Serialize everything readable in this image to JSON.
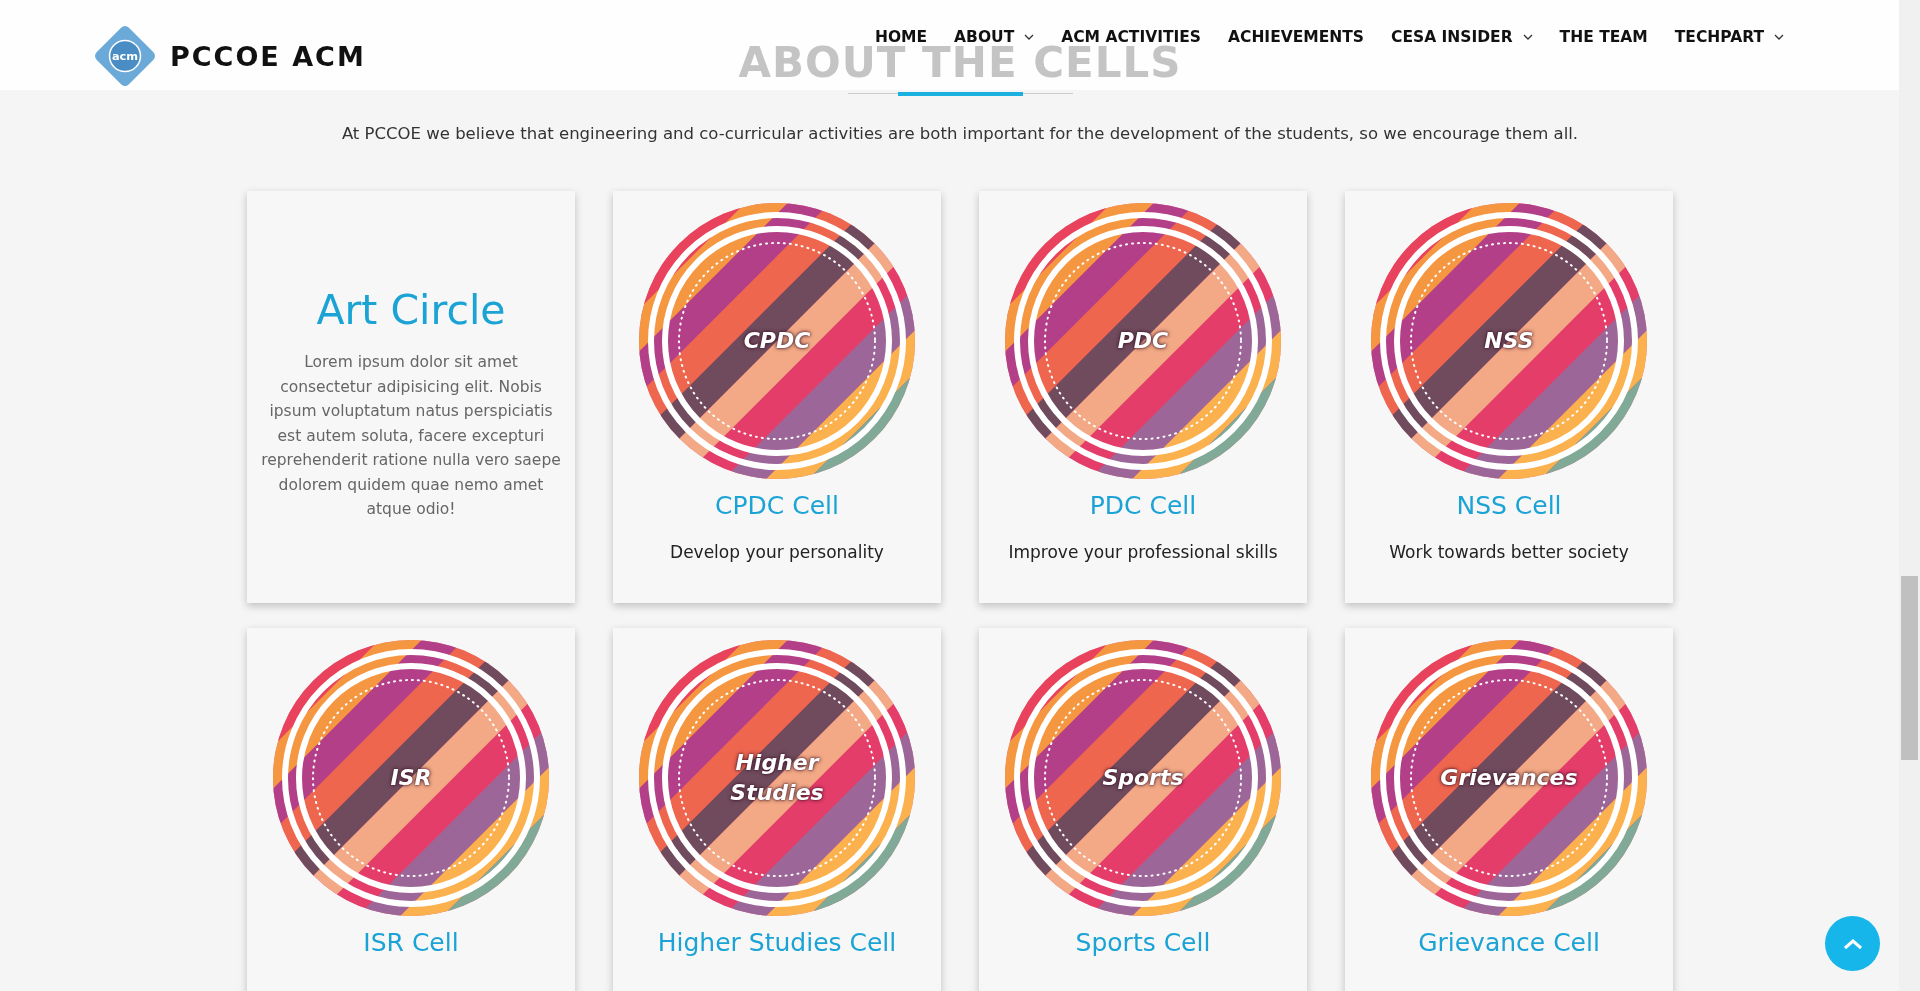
{
  "header": {
    "brand": "PCCOE ACM",
    "logo_text": "acm",
    "nav": [
      {
        "label": "HOME",
        "dropdown": false
      },
      {
        "label": "ABOUT",
        "dropdown": true
      },
      {
        "label": "ACM ACTIVITIES",
        "dropdown": false
      },
      {
        "label": "ACHIEVEMENTS",
        "dropdown": false
      },
      {
        "label": "CESA INSIDER",
        "dropdown": true
      },
      {
        "label": "THE TEAM",
        "dropdown": false
      },
      {
        "label": "TECHPART",
        "dropdown": true
      }
    ]
  },
  "section": {
    "title": "ABOUT THE CELLS",
    "intro": "At PCCOE we believe that engineering and co-curricular activities are both important for the development of the students, so we encourage them all."
  },
  "cards": [
    {
      "kind": "text",
      "title": "Art Circle",
      "body": "Lorem ipsum dolor sit amet consectetur adipisicing elit. Nobis ipsum voluptatum natus perspiciatis est autem soluta, facere excepturi reprehenderit ratione nulla vero saepe dolorem quidem quae nemo amet atque odio!"
    },
    {
      "kind": "badge",
      "badge_text": "CPDC",
      "title": "CPDC Cell",
      "description": "Develop your personality"
    },
    {
      "kind": "badge",
      "badge_text": "PDC",
      "title": "PDC Cell",
      "description": "Improve your professional skills"
    },
    {
      "kind": "badge",
      "badge_text": "NSS",
      "title": "NSS Cell",
      "description": "Work towards better society"
    },
    {
      "kind": "badge",
      "badge_text": "ISR",
      "title": "ISR Cell"
    },
    {
      "kind": "badge",
      "badge_text": "Higher Studies",
      "title": "Higher Studies Cell"
    },
    {
      "kind": "badge",
      "badge_text": "Sports",
      "title": "Sports Cell"
    },
    {
      "kind": "badge",
      "badge_text": "Grievances",
      "title": "Grievance Cell"
    }
  ]
}
